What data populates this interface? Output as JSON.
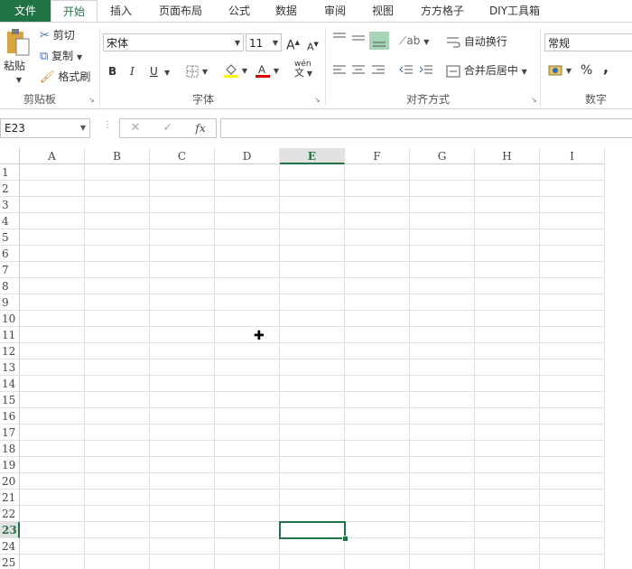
{
  "tabs": [
    "文件",
    "开始",
    "插入",
    "页面布局",
    "公式",
    "数据",
    "审阅",
    "视图",
    "方方格子",
    "DIY工具箱"
  ],
  "clipboard": {
    "paste": "粘贴",
    "cut": "剪切",
    "copy": "复制",
    "format_painter": "格式刷",
    "group": "剪贴板"
  },
  "font": {
    "name": "宋体",
    "size": "11",
    "bold": "B",
    "italic": "I",
    "underline": "U",
    "grow": "A",
    "shrink": "A",
    "phonetic": "wén",
    "group": "字体"
  },
  "align": {
    "wrap": "自动换行",
    "merge": "合并后居中",
    "group": "对齐方式"
  },
  "number": {
    "format": "常规",
    "percent": "%",
    "comma": ",",
    "group": "数字"
  },
  "formula": {
    "name_box": "E23",
    "fx": "fx",
    "cancel": "✕",
    "enter": "✓",
    "value": ""
  },
  "columns": [
    "A",
    "B",
    "C",
    "D",
    "E",
    "F",
    "G",
    "H",
    "I"
  ],
  "rows": [
    "1",
    "2",
    "3",
    "4",
    "5",
    "6",
    "7",
    "8",
    "9",
    "10",
    "11",
    "12",
    "13",
    "14",
    "15",
    "16",
    "17",
    "18",
    "19",
    "20",
    "21",
    "22",
    "23",
    "24",
    "25"
  ],
  "selection": {
    "column": "E",
    "row": "23"
  }
}
